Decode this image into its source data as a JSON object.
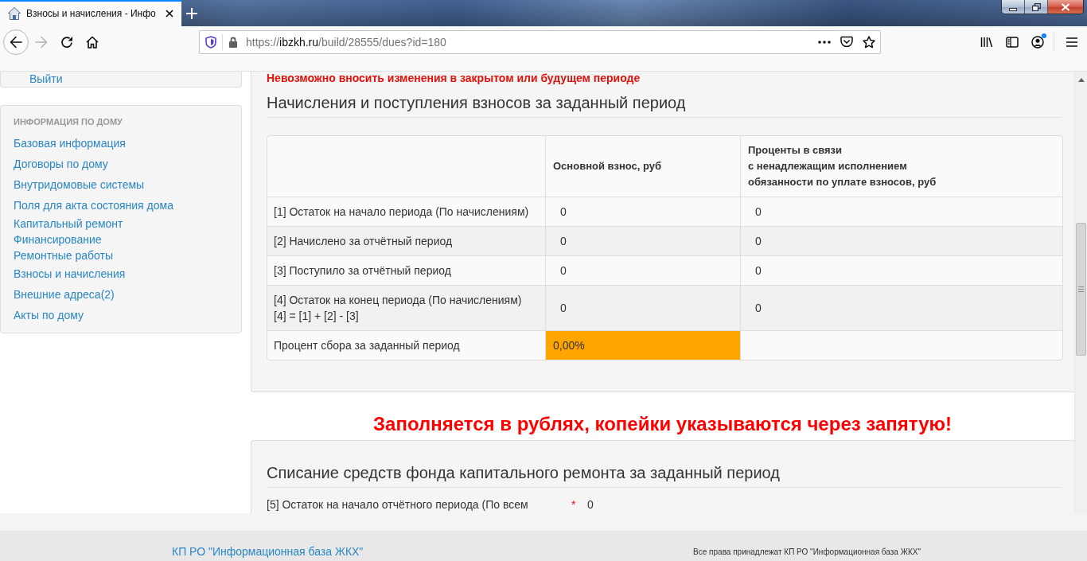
{
  "browser": {
    "tabs": [
      {
        "title": "Взносы и начисления - Инфо",
        "selected": true
      }
    ],
    "nav_buttons": [
      {
        "kind": "back",
        "disabled": false
      },
      {
        "kind": "forward",
        "disabled": true
      },
      {
        "kind": "reload",
        "disabled": false
      },
      {
        "kind": "home",
        "disabled": false
      }
    ],
    "url": {
      "scheme": "https://",
      "host": "ibzkh.ru",
      "path": "/build/28555/dues?id=180"
    },
    "account_badge": true
  },
  "sidebar": {
    "user_links": [
      "Выйти"
    ],
    "house_menu": {
      "heading": "ИНФОРМАЦИЯ ПО ДОМУ",
      "items": [
        {
          "label": "Базовая информация",
          "kind": "link"
        },
        {
          "label": "Договоры по дому",
          "kind": "link"
        },
        {
          "label": "Внутридомовые системы",
          "kind": "link"
        },
        {
          "label": "Поля для акта состояния дома",
          "kind": "link"
        },
        {
          "label": "Капитальный ремонт",
          "kind": "compact"
        },
        {
          "label": "Финансирование",
          "kind": "compact"
        },
        {
          "label": "Ремонтные работы",
          "kind": "compact"
        },
        {
          "label": "Взносы и начисления",
          "kind": "link"
        },
        {
          "label": "Внешние адреса(2)",
          "kind": "link"
        },
        {
          "label": "Акты по дому",
          "kind": "link"
        }
      ]
    }
  },
  "dues_panel": {
    "notice": "Невозможно вносить изменения в закрытом или будущем периоде",
    "title": "Начисления и поступления взносов за заданный период",
    "table": {
      "columns": [
        "Основной взнос, руб",
        "Проценты в связи\nс ненадлежащим исполнением\nобязанности по уплате взносов, руб"
      ],
      "rows": [
        {
          "label": "[1] Остаток на начало периода (По начислениям)",
          "values": [
            "0",
            "0"
          ],
          "highlighted": false
        },
        {
          "label": "[2] Начислено за отчётный период",
          "values": [
            "0",
            "0"
          ],
          "highlighted": false
        },
        {
          "label": "[3] Поступило за отчётный период",
          "values": [
            "0",
            "0"
          ],
          "highlighted": false
        },
        {
          "label": "[4] Остаток на конец периода (По начислениям)\n[4] = [1] + [2] - [3]",
          "values": [
            "0",
            "0"
          ],
          "highlighted": false
        },
        {
          "label": "Процент сбора за заданный период",
          "values": [
            "0,00%"
          ],
          "highlighted": true
        }
      ]
    }
  },
  "hint": "Заполняется в рублях, копейки указываются через запятую!",
  "writeoff_panel": {
    "title": "Списание средств фонда капитального ремонта за заданный период",
    "fields": [
      {
        "label": "[5] Остаток на начало отчётного периода (По всем",
        "required_mark": "*",
        "value": "0"
      }
    ]
  },
  "footer": {
    "link": "КП РО \"Информационная база ЖКХ\"",
    "copyright": "Все права принадлежат КП РО \"Информационная база ЖКХ\""
  }
}
